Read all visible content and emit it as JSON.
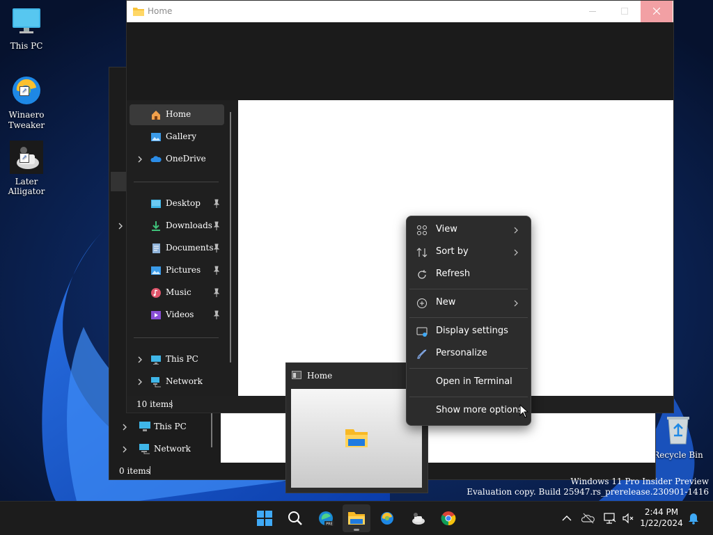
{
  "desktop": {
    "icons": [
      {
        "label": "This PC"
      },
      {
        "label": "Winaero Tweaker"
      },
      {
        "label": "Later Alligator"
      },
      {
        "label": "Recycle Bin"
      }
    ]
  },
  "back_window": {
    "sidebar": [
      {
        "label": "This PC"
      },
      {
        "label": "Network"
      }
    ],
    "status": "0 items"
  },
  "window": {
    "title": "Home",
    "sidebar": {
      "items": [
        {
          "label": "Home"
        },
        {
          "label": "Gallery"
        },
        {
          "label": "OneDrive"
        },
        {
          "label": "Desktop"
        },
        {
          "label": "Downloads"
        },
        {
          "label": "Documents"
        },
        {
          "label": "Pictures"
        },
        {
          "label": "Music"
        },
        {
          "label": "Videos"
        },
        {
          "label": "This PC"
        },
        {
          "label": "Network"
        }
      ]
    },
    "status": "10 items"
  },
  "context_menu": {
    "items": [
      {
        "label": "View"
      },
      {
        "label": "Sort by"
      },
      {
        "label": "Refresh"
      },
      {
        "label": "New"
      },
      {
        "label": "Display settings"
      },
      {
        "label": "Personalize"
      },
      {
        "label": "Open in Terminal"
      },
      {
        "label": "Show more options"
      }
    ]
  },
  "thumbnail": {
    "title": "Home"
  },
  "watermark": {
    "line1": "Windows 11 Pro Insider Preview",
    "line2": "Evaluation copy. Build 25947.rs_prerelease.230901-1416"
  },
  "taskbar": {
    "time": "2:44 PM",
    "date": "1/22/2024",
    "accent": "#0078d4"
  }
}
